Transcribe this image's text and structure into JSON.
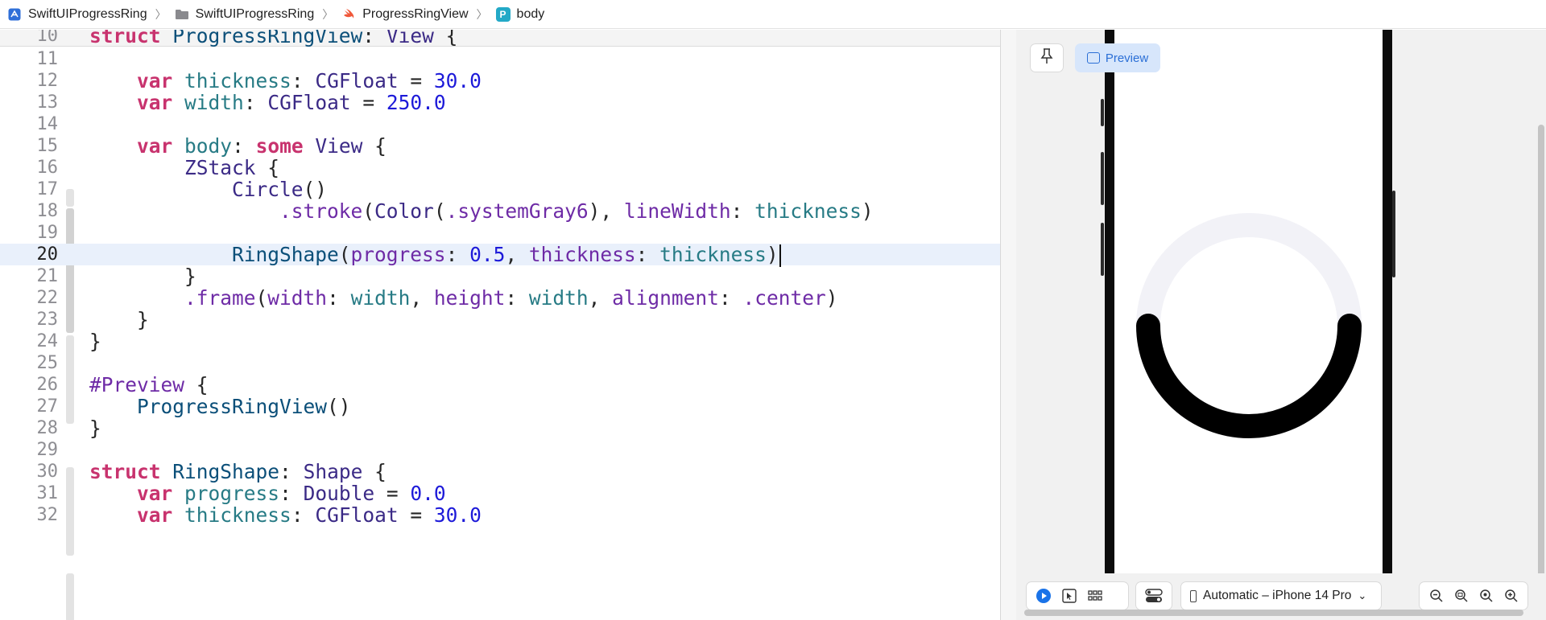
{
  "breadcrumb": [
    {
      "label": "SwiftUIProgressRing",
      "icon": "app-icon"
    },
    {
      "label": "SwiftUIProgressRing",
      "icon": "folder-icon"
    },
    {
      "label": "ProgressRingView",
      "icon": "swift-icon"
    },
    {
      "label": "body",
      "icon": "property-p-icon",
      "badge": "P"
    }
  ],
  "editor": {
    "active_line": 20,
    "lines": [
      {
        "num": "10",
        "code": "struct ProgressRingView: View {"
      },
      {
        "num": "11",
        "code": ""
      },
      {
        "num": "12",
        "code": "    var thickness: CGFloat = 30.0"
      },
      {
        "num": "13",
        "code": "    var width: CGFloat = 250.0"
      },
      {
        "num": "14",
        "code": ""
      },
      {
        "num": "15",
        "code": "    var body: some View {"
      },
      {
        "num": "16",
        "code": "        ZStack {"
      },
      {
        "num": "17",
        "code": "            Circle()"
      },
      {
        "num": "18",
        "code": "                .stroke(Color(.systemGray6), lineWidth: thickness)"
      },
      {
        "num": "19",
        "code": ""
      },
      {
        "num": "20",
        "code": "            RingShape(progress: 0.5, thickness: thickness)"
      },
      {
        "num": "21",
        "code": "        }"
      },
      {
        "num": "22",
        "code": "        .frame(width: width, height: width, alignment: .center)"
      },
      {
        "num": "23",
        "code": "    }"
      },
      {
        "num": "24",
        "code": "}"
      },
      {
        "num": "25",
        "code": ""
      },
      {
        "num": "26",
        "code": "#Preview {"
      },
      {
        "num": "27",
        "code": "    ProgressRingView()"
      },
      {
        "num": "28",
        "code": "}"
      },
      {
        "num": "29",
        "code": ""
      },
      {
        "num": "30",
        "code": "struct RingShape: Shape {"
      },
      {
        "num": "31",
        "code": "    var progress: Double = 0.0"
      },
      {
        "num": "32",
        "code": "    var thickness: CGFloat = 30.0"
      }
    ]
  },
  "preview": {
    "pin_label": "",
    "preview_label": "Preview",
    "device_label": "Automatic – iPhone 14 Pro",
    "ring_progress": 0.5,
    "ring_track_color": "#f2f2f7",
    "ring_fill_color": "#000000",
    "accent_color": "#2b6fd6",
    "bottom_icons": [
      "live-play-icon",
      "selectable-cursor-icon",
      "variants-grid-icon",
      "device-settings-icon",
      "zoom-out-icon",
      "zoom-fit-icon",
      "zoom-100-icon",
      "zoom-in-icon"
    ]
  }
}
